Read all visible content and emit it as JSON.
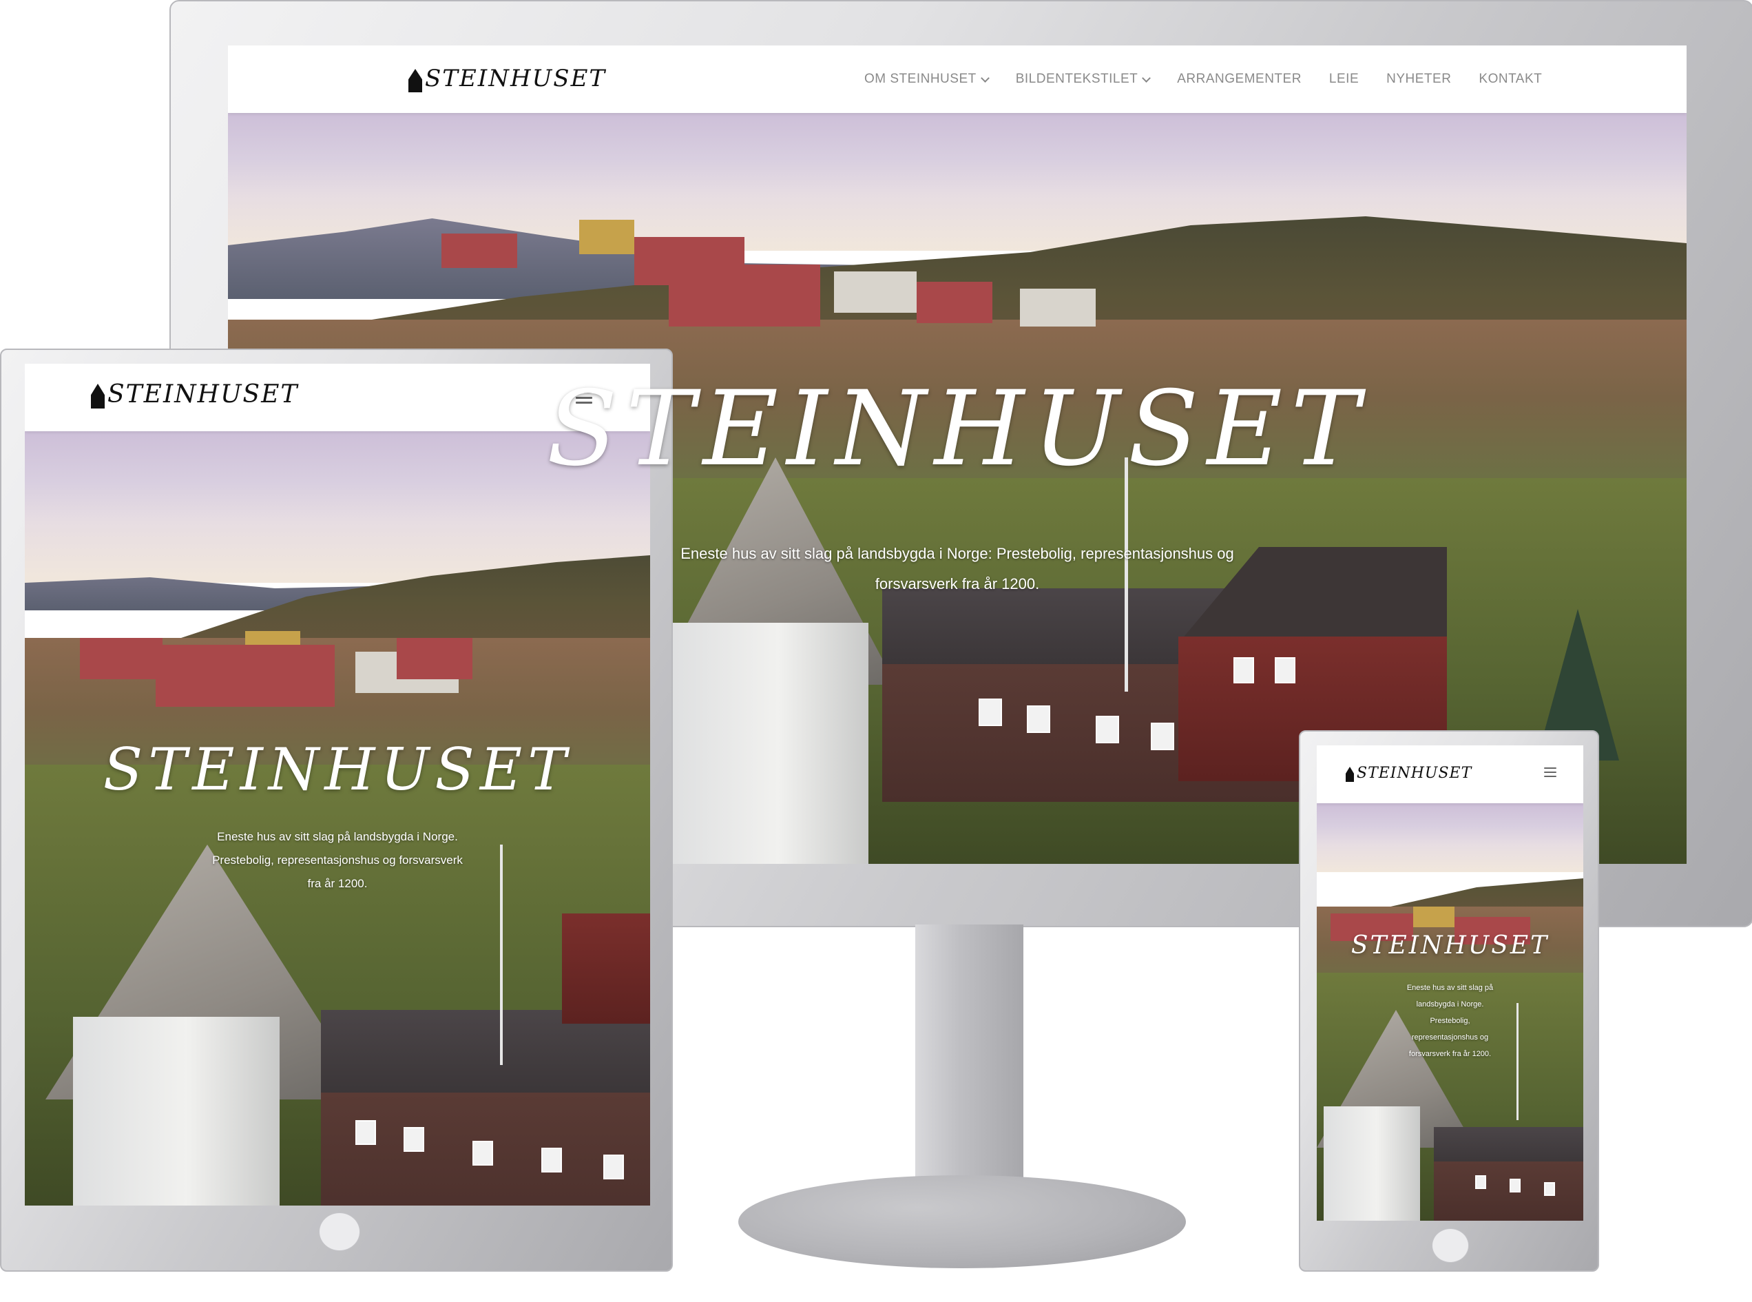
{
  "brand": {
    "logo_text": "STEINHUSET"
  },
  "desktop": {
    "nav": [
      {
        "label": "OM STEINHUSET",
        "has_dropdown": true
      },
      {
        "label": "BILDENTEKSTILET",
        "has_dropdown": true
      },
      {
        "label": "ARRANGEMENTER",
        "has_dropdown": false
      },
      {
        "label": "LEIE",
        "has_dropdown": false
      },
      {
        "label": "NYHETER",
        "has_dropdown": false
      },
      {
        "label": "KONTAKT",
        "has_dropdown": false
      }
    ],
    "hero_title": "STEINHUSET",
    "hero_line1": "Eneste hus av sitt slag på landsbygda i Norge: Prestebolig, representasjonshus og",
    "hero_line2": "forsvarsverk fra år 1200."
  },
  "tablet": {
    "hero_title": "STEINHUSET",
    "hero_line1": "Eneste hus av sitt slag på landsbygda i Norge.",
    "hero_line2": "Prestebolig, representasjonshus og forsvarsverk",
    "hero_line3": "fra år 1200."
  },
  "phone": {
    "hero_title": "STEINHUSET",
    "hero_line1": "Eneste hus av sitt slag på",
    "hero_line2": "landsbygda i Norge.",
    "hero_line3": "Prestebolig,",
    "hero_line4": "representasjonshus og",
    "hero_line5": "forsvarsverk fra år 1200."
  },
  "colors": {
    "nav_text": "#8a8a8a",
    "logo": "#111111",
    "hero_text": "#ffffff",
    "device_frame": "#c9c9cc"
  },
  "icons": {
    "menu": "hamburger-icon",
    "dropdown": "chevron-down-icon",
    "logo_mark": "church-tower-icon"
  }
}
